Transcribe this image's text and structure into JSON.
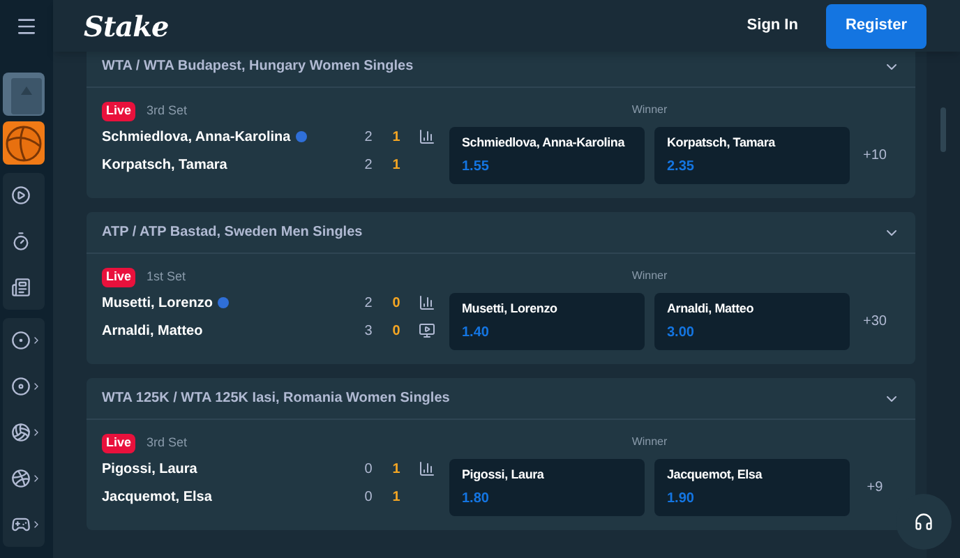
{
  "header": {
    "logo": "Stake",
    "sign_in": "Sign In",
    "register": "Register"
  },
  "sidebar": {
    "thumbnails": [
      {
        "kind": "cards"
      },
      {
        "kind": "ball"
      }
    ],
    "groups": [
      [
        {
          "kind": "play",
          "expandable": false
        },
        {
          "kind": "stopwatch",
          "expandable": false
        },
        {
          "kind": "news",
          "expandable": false
        }
      ],
      [
        {
          "kind": "soccer",
          "expandable": true
        },
        {
          "kind": "tennis",
          "expandable": true
        },
        {
          "kind": "baseball",
          "expandable": true
        },
        {
          "kind": "basketball",
          "expandable": true
        },
        {
          "kind": "esports",
          "expandable": true
        }
      ]
    ]
  },
  "matches": [
    {
      "competition": "WTA / WTA Budapest, Hungary Women Singles",
      "live": "Live",
      "period": "3rd Set",
      "market": "Winner",
      "more": "+10",
      "teams": [
        {
          "name": "Schmiedlova, Anna-Karolina",
          "serving": true,
          "sets": "2",
          "games": "1",
          "kind": "stats"
        },
        {
          "name": "Korpatsch, Tamara",
          "serving": false,
          "sets": "2",
          "games": "1",
          "kind": "plain"
        }
      ],
      "odds": [
        {
          "name": "Schmiedlova, Anna-Karolina",
          "price": "1.55"
        },
        {
          "name": "Korpatsch, Tamara",
          "price": "2.35"
        }
      ]
    },
    {
      "competition": "ATP / ATP Bastad, Sweden Men Singles",
      "live": "Live",
      "period": "1st Set",
      "market": "Winner",
      "more": "+30",
      "teams": [
        {
          "name": "Musetti, Lorenzo",
          "serving": true,
          "sets": "2",
          "games": "0",
          "kind": "stats"
        },
        {
          "name": "Arnaldi, Matteo",
          "serving": false,
          "sets": "3",
          "games": "0",
          "kind": "tv"
        }
      ],
      "odds": [
        {
          "name": "Musetti, Lorenzo",
          "price": "1.40"
        },
        {
          "name": "Arnaldi, Matteo",
          "price": "3.00"
        }
      ]
    },
    {
      "competition": "WTA 125K / WTA 125K Iasi, Romania Women Singles",
      "live": "Live",
      "period": "3rd Set",
      "market": "Winner",
      "more": "+9",
      "teams": [
        {
          "name": "Pigossi, Laura",
          "serving": false,
          "sets": "0",
          "games": "1",
          "kind": "stats"
        },
        {
          "name": "Jacquemot, Elsa",
          "serving": false,
          "sets": "0",
          "games": "1",
          "kind": "plain"
        }
      ],
      "odds": [
        {
          "name": "Pigossi, Laura",
          "price": "1.80"
        },
        {
          "name": "Jacquemot, Elsa",
          "price": "1.90"
        }
      ]
    }
  ]
}
